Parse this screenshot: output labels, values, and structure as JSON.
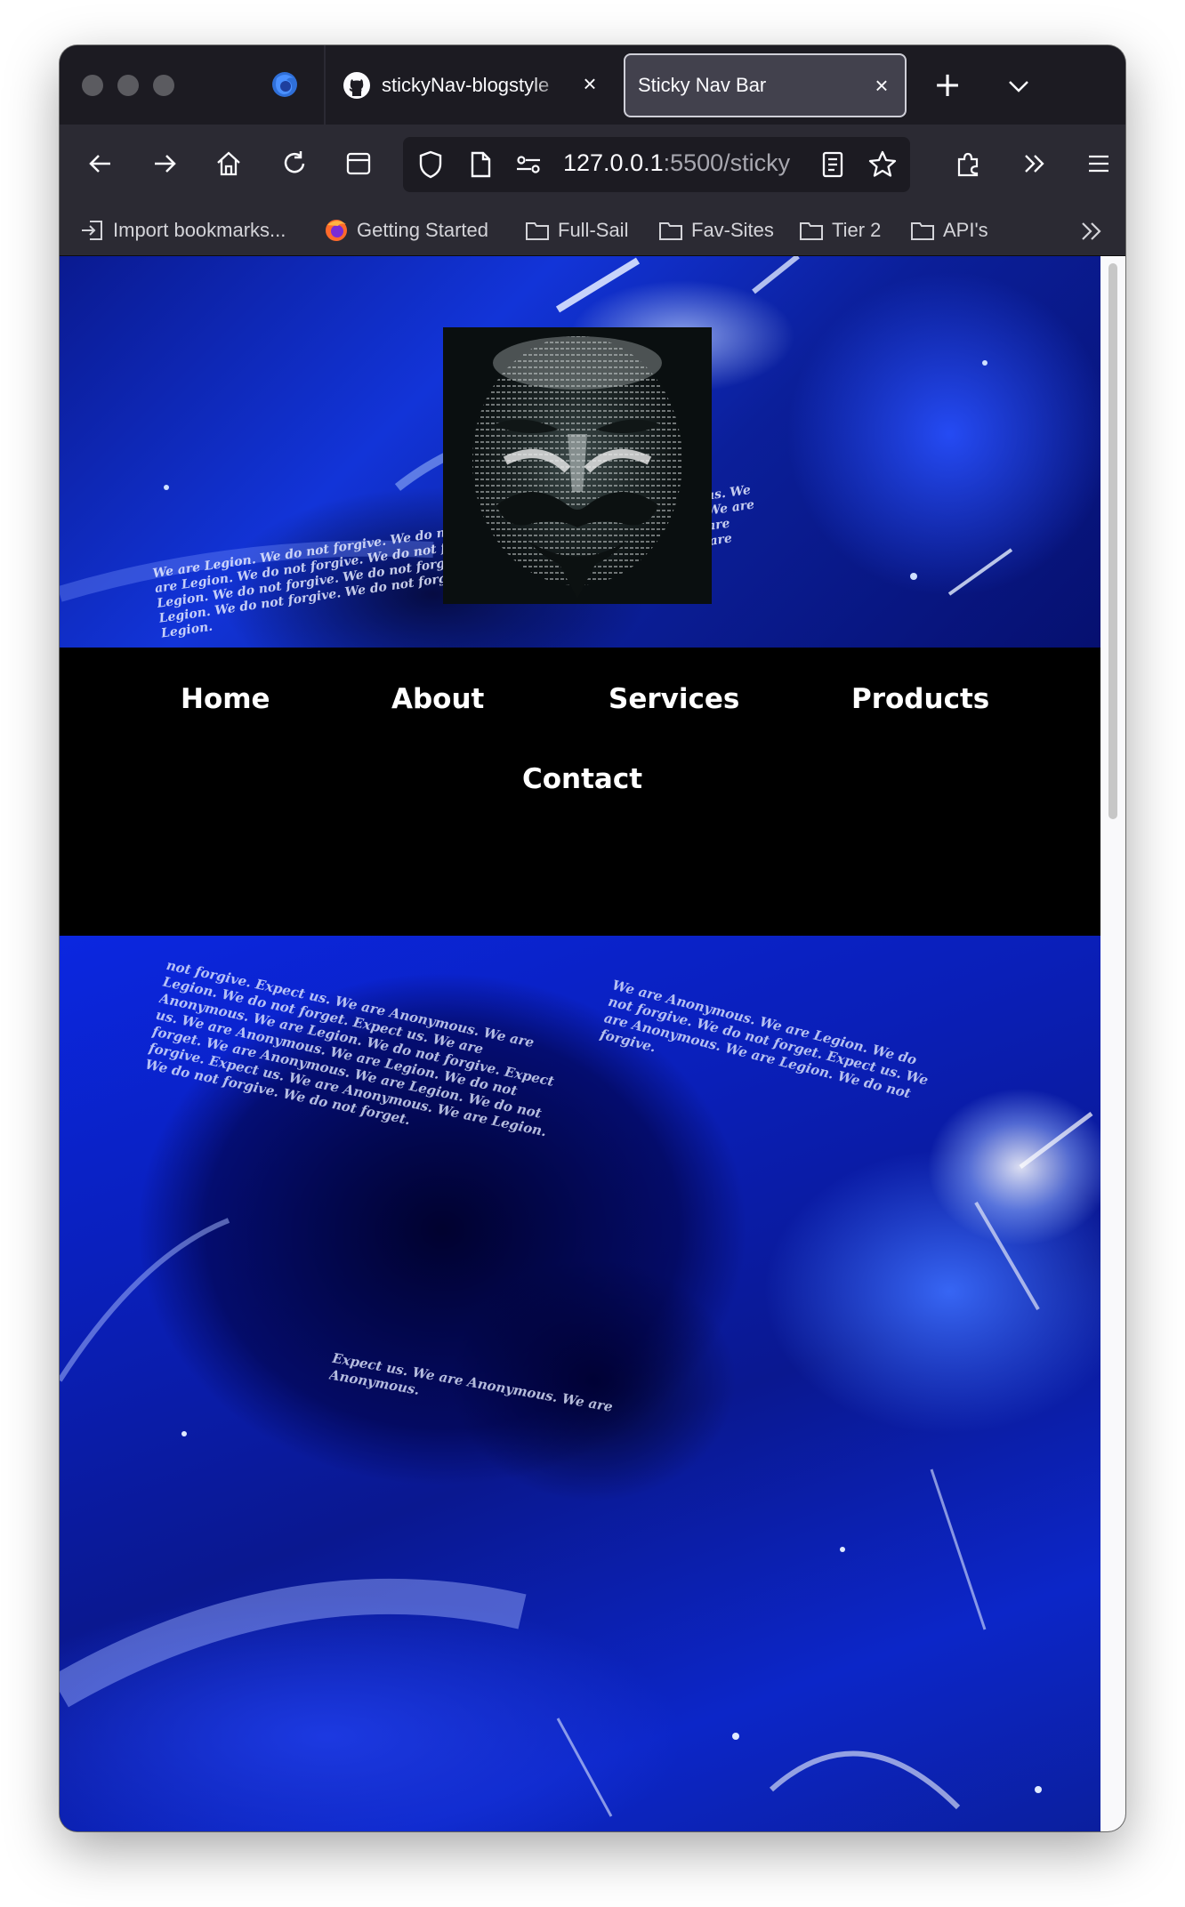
{
  "browser": {
    "tabs": [
      {
        "title": "stickyNav-blogstyle",
        "active": false
      },
      {
        "title": "Sticky Nav Bar",
        "active": true
      }
    ],
    "url": {
      "host": "127.0.0.1",
      "rest": ":5500/sticky"
    },
    "bookmarks": [
      {
        "label": "Import bookmarks...",
        "icon": "import-icon"
      },
      {
        "label": "Getting Started",
        "icon": "firefox-icon"
      },
      {
        "label": "Full-Sail",
        "icon": "folder-icon"
      },
      {
        "label": "Fav-Sites",
        "icon": "folder-icon"
      },
      {
        "label": "Tier 2",
        "icon": "folder-icon"
      },
      {
        "label": "API's",
        "icon": "folder-icon"
      }
    ]
  },
  "site": {
    "nav": {
      "home": "Home",
      "about": "About",
      "services": "Services",
      "products": "Products",
      "contact": "Contact"
    }
  },
  "colors": {
    "nav_background": "#000000",
    "nav_text": "#ffffff",
    "hero_blue": "#1234d8"
  }
}
